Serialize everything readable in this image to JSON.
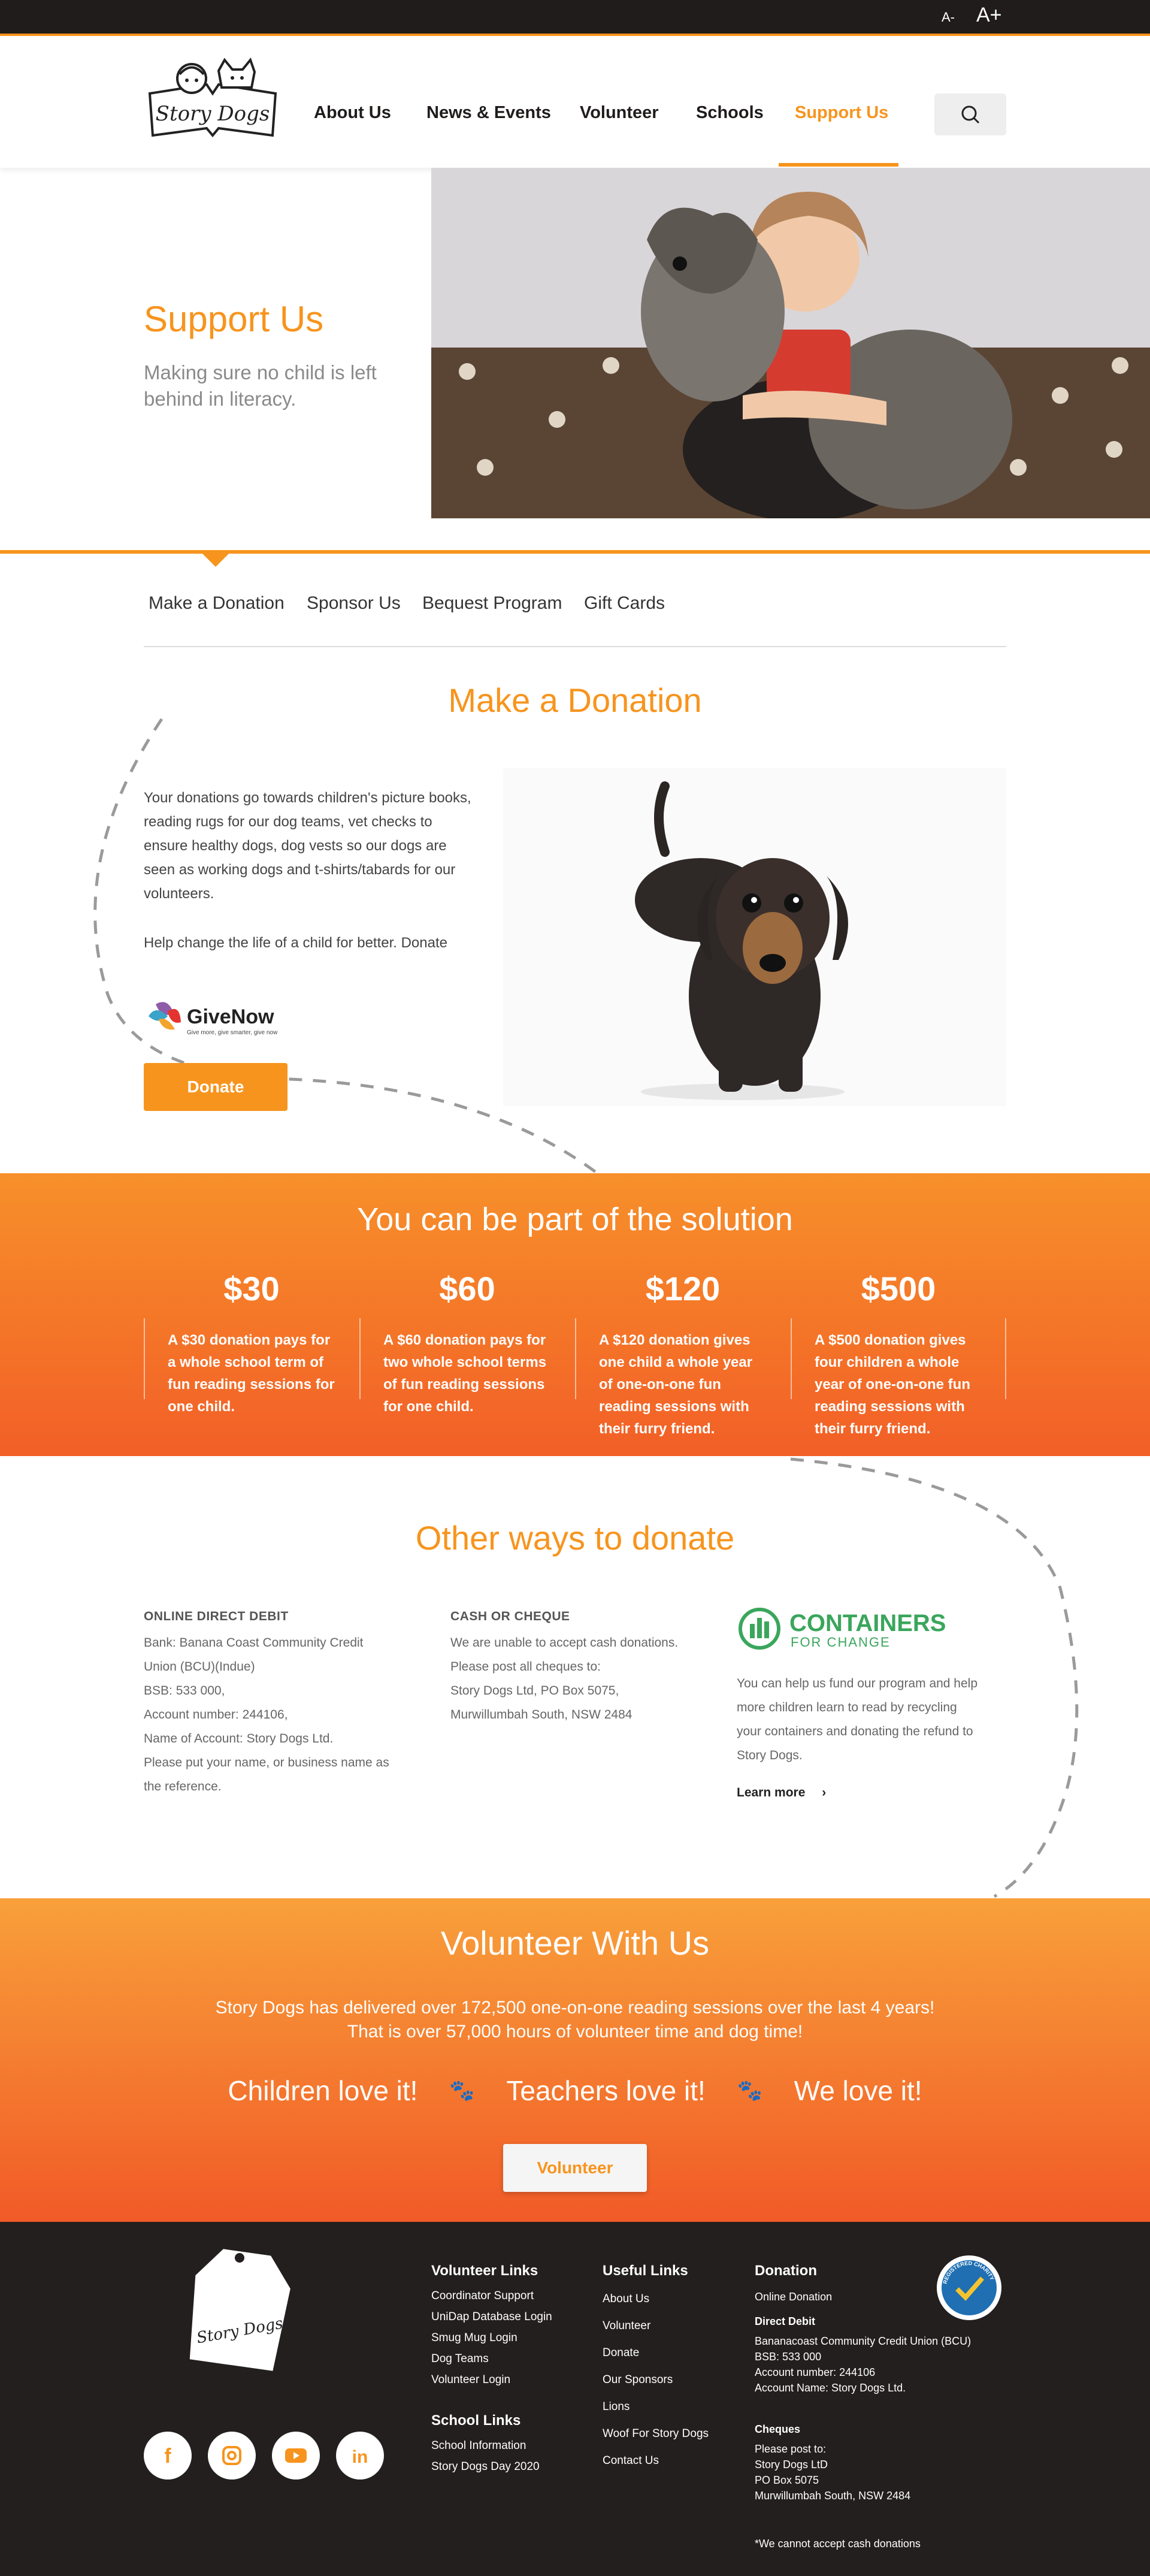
{
  "topbar": {
    "font_small": "A-",
    "font_large": "A+"
  },
  "header": {
    "logo_text": "Story Dogs",
    "nav": [
      "About Us",
      "News & Events",
      "Volunteer",
      "Schools",
      "Support Us"
    ],
    "active_nav": "Support Us"
  },
  "hero": {
    "title": "Support Us",
    "subtitle": "Making sure no child is left behind in literacy."
  },
  "subnav": [
    "Make a Donation",
    "Sponsor Us",
    "Bequest Program",
    "Gift Cards"
  ],
  "donation": {
    "title": "Make a Donation",
    "text": "Your donations go towards children's picture books, reading rugs for our dog teams, vet checks to ensure healthy dogs, dog vests so our dogs are seen as working dogs and t-shirts/tabards for our volunteers.",
    "text2": "Help change the life of a child for better. Donate",
    "givenow_name": "GiveNow",
    "givenow_tag": "Give more, give smarter, give now",
    "button": "Donate"
  },
  "solution": {
    "title": "You can be part of the solution",
    "items": [
      {
        "amount": "$30",
        "desc": "A $30 donation pays for a whole school term of fun reading sessions for one child."
      },
      {
        "amount": "$60",
        "desc": "A $60 donation pays for two whole school terms of fun reading sessions for one child."
      },
      {
        "amount": "$120",
        "desc": "A $120 donation gives one child a whole year of one-on-one fun reading sessions with their furry friend."
      },
      {
        "amount": "$500",
        "desc": "A $500 donation gives four children a whole year of one-on-one fun reading sessions with their furry friend."
      }
    ]
  },
  "other": {
    "title": "Other ways to donate",
    "direct": {
      "head": "ONLINE DIRECT DEBIT",
      "lines": [
        "Bank: Banana Coast Community Credit",
        "Union (BCU)(Indue)",
        "BSB: 533 000,",
        "Account number: 244106,",
        "Name of Account: Story Dogs Ltd.",
        "Please put your name, or business name as",
        "the reference."
      ]
    },
    "cash": {
      "head": "CASH OR CHEQUE",
      "lines": [
        "We are unable to accept cash donations.",
        "Please post all cheques to:",
        "Story Dogs Ltd, PO Box 5075,",
        "Murwillumbah South, NSW 2484"
      ]
    },
    "containers": {
      "name": "CONTAINERS",
      "sub": "FOR CHANGE",
      "lines": [
        "You can help us fund our program and help",
        "more children learn to read by recycling",
        "your containers and donating the refund to",
        "Story Dogs."
      ],
      "link": "Learn more"
    }
  },
  "volunteer": {
    "title": "Volunteer With Us",
    "line1": "Story Dogs has delivered over 172,500 one-on-one reading sessions over the last 4 years!",
    "line2": "That is over 57,000 hours of volunteer time and dog time!",
    "love": [
      "Children love it!",
      "Teachers love it!",
      "We love it!"
    ],
    "button": "Volunteer"
  },
  "footer": {
    "volunteer_links": {
      "head": "Volunteer Links",
      "items": [
        "Coordinator Support",
        "UniDap Database Login",
        "Smug Mug Login",
        "Dog Teams",
        "Volunteer Login"
      ]
    },
    "school_links": {
      "head": "School Links",
      "items": [
        "School Information",
        "Story Dogs Day 2020"
      ]
    },
    "useful_links": {
      "head": "Useful Links",
      "items": [
        "About Us",
        "Volunteer",
        "Donate",
        "Our Sponsors",
        "Lions",
        "Woof For Story Dogs",
        "Contact Us"
      ]
    },
    "donation": {
      "head": "Donation",
      "online": "Online Donation",
      "direct_head": "Direct Debit",
      "direct_lines": [
        "Bananacoast Community Credit Union (BCU)",
        "BSB: 533 000",
        "Account number: 244106",
        "Account Name: Story Dogs Ltd."
      ],
      "cheques_head": "Cheques",
      "cheques_lines": [
        "Please post to:",
        "Story Dogs LtD",
        "PO Box 5075",
        "Murwillumbah South, NSW 2484"
      ],
      "note": "*We cannot accept cash donations"
    },
    "charity_badge": "REGISTERED CHARITY",
    "social": [
      "facebook-icon",
      "instagram-icon",
      "youtube-icon",
      "linkedin-icon"
    ]
  },
  "colors": {
    "accent": "#f7941d",
    "dark": "#231f1e",
    "green": "#3aa65c"
  }
}
